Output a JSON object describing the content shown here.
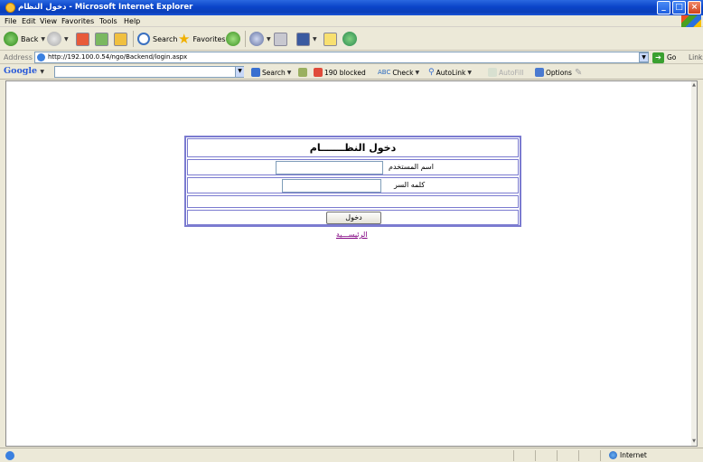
{
  "window": {
    "title": "دخول النظام - Microsoft Internet Explorer"
  },
  "menu": [
    "File",
    "Edit",
    "View",
    "Favorites",
    "Tools",
    "Help"
  ],
  "toolbar": {
    "back": "Back",
    "search": "Search",
    "favorites": "Favorites"
  },
  "address": {
    "label": "Address",
    "url": "http://192.100.0.54/ngo/Backend/login.aspx",
    "go": "Go",
    "links": "Links"
  },
  "googlebar": {
    "logo": "Google",
    "search": "Search",
    "blocked": "190 blocked",
    "check": "Check",
    "autolink": "AutoLink",
    "autofill": "AutoFill",
    "options": "Options"
  },
  "login": {
    "heading": "دخول النظـــــــام",
    "username_label": "اسم المستخدم",
    "username_value": "",
    "password_label": "كلمه السر",
    "password_value": "",
    "submit_label": "دخول",
    "home_link": "الرئيســـية"
  },
  "status": {
    "zone": "Internet"
  },
  "colors": {
    "table_border": "#7b7bd0",
    "visited_link": "#800080",
    "titlebar": "#0a44c8"
  }
}
